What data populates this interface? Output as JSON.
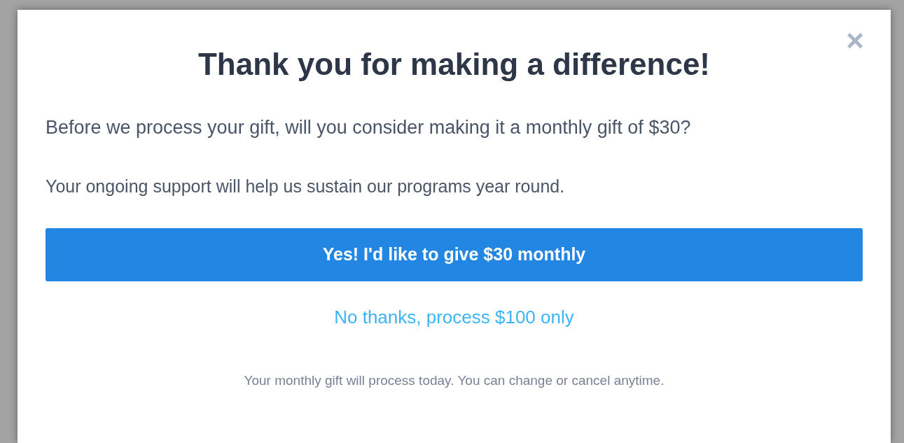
{
  "dialog": {
    "close": "×",
    "title": "Thank you for making a difference!",
    "message": "Before we process your gift, will you consider making it a monthly gift of $30?",
    "note": "Your ongoing support will help us sustain our programs year round.",
    "accept_button": "Yes! I'd like to give $30 monthly",
    "decline_link": "No thanks, process $100 only",
    "footer": "Your monthly gift will process today. You can change or cancel anytime."
  }
}
